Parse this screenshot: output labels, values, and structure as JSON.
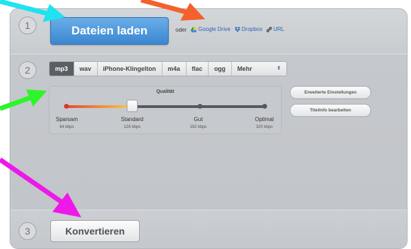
{
  "steps": [
    "1",
    "2",
    "3"
  ],
  "upload": {
    "button_label": "Dateien laden",
    "or_label": "oder",
    "links": [
      {
        "label": "Google Drive",
        "icon": "google-drive-icon"
      },
      {
        "label": "Dropbox",
        "icon": "dropbox-icon"
      },
      {
        "label": "URL",
        "icon": "link-icon"
      }
    ]
  },
  "formats": {
    "items": [
      "mp3",
      "wav",
      "iPhone-Klingelton",
      "m4a",
      "flac",
      "ogg"
    ],
    "selected": "mp3",
    "more_label": "Mehr",
    "more_icon": "up-down-chevron-icon"
  },
  "quality": {
    "title": "Qualität",
    "selected_index": 1,
    "levels": [
      {
        "label": "Sparsam",
        "kbps": "64 kbps"
      },
      {
        "label": "Standard",
        "kbps": "128 kbps"
      },
      {
        "label": "Gut",
        "kbps": "192 kbps"
      },
      {
        "label": "Optimal",
        "kbps": "320 kbps"
      }
    ]
  },
  "settings": {
    "advanced_label": "Erweiterte Einstellungen",
    "track_info_label": "Titelinfo bearbeiten"
  },
  "convert": {
    "button_label": "Konvertieren"
  },
  "colors": {
    "arrow_cyan": "#1fe3ef",
    "arrow_orange": "#f4612c",
    "arrow_green": "#2ef52b",
    "arrow_magenta": "#ee19e9",
    "upload_blue": "#3b86d1"
  }
}
